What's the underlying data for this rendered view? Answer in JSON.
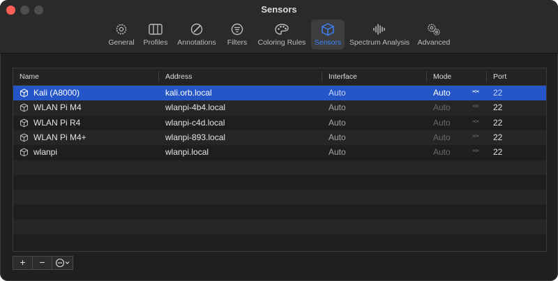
{
  "window": {
    "title": "Sensors"
  },
  "toolbar": {
    "items": [
      {
        "label": "General",
        "icon": "gear-icon"
      },
      {
        "label": "Profiles",
        "icon": "columns-icon"
      },
      {
        "label": "Annotations",
        "icon": "pen-circle-icon"
      },
      {
        "label": "Filters",
        "icon": "filter-icon"
      },
      {
        "label": "Coloring Rules",
        "icon": "palette-icon"
      },
      {
        "label": "Sensors",
        "icon": "cube-icon",
        "active": true
      },
      {
        "label": "Spectrum Analysis",
        "icon": "waveform-icon"
      },
      {
        "label": "Advanced",
        "icon": "gears-icon"
      }
    ],
    "accent": "#3b82f6"
  },
  "table": {
    "headers": {
      "name": "Name",
      "address": "Address",
      "interface": "Interface",
      "mode": "Mode",
      "port": "Port"
    },
    "rows": [
      {
        "name": "Kali (A8000)",
        "address": "kali.orb.local",
        "interface": "Auto",
        "mode": "Auto",
        "port": "22",
        "selected": true
      },
      {
        "name": "WLAN Pi M4",
        "address": "wlanpi-4b4.local",
        "interface": "Auto",
        "mode": "Auto",
        "port": "22"
      },
      {
        "name": "WLAN Pi R4",
        "address": "wlanpi-c4d.local",
        "interface": "Auto",
        "mode": "Auto",
        "port": "22"
      },
      {
        "name": "WLAN Pi M4+",
        "address": "wlanpi-893.local",
        "interface": "Auto",
        "mode": "Auto",
        "port": "22"
      },
      {
        "name": "wlanpi",
        "address": "wlanpi.local",
        "interface": "Auto",
        "mode": "Auto",
        "port": "22"
      }
    ],
    "selection_color": "#2456c8"
  },
  "bottom": {
    "add": "+",
    "remove": "−"
  }
}
